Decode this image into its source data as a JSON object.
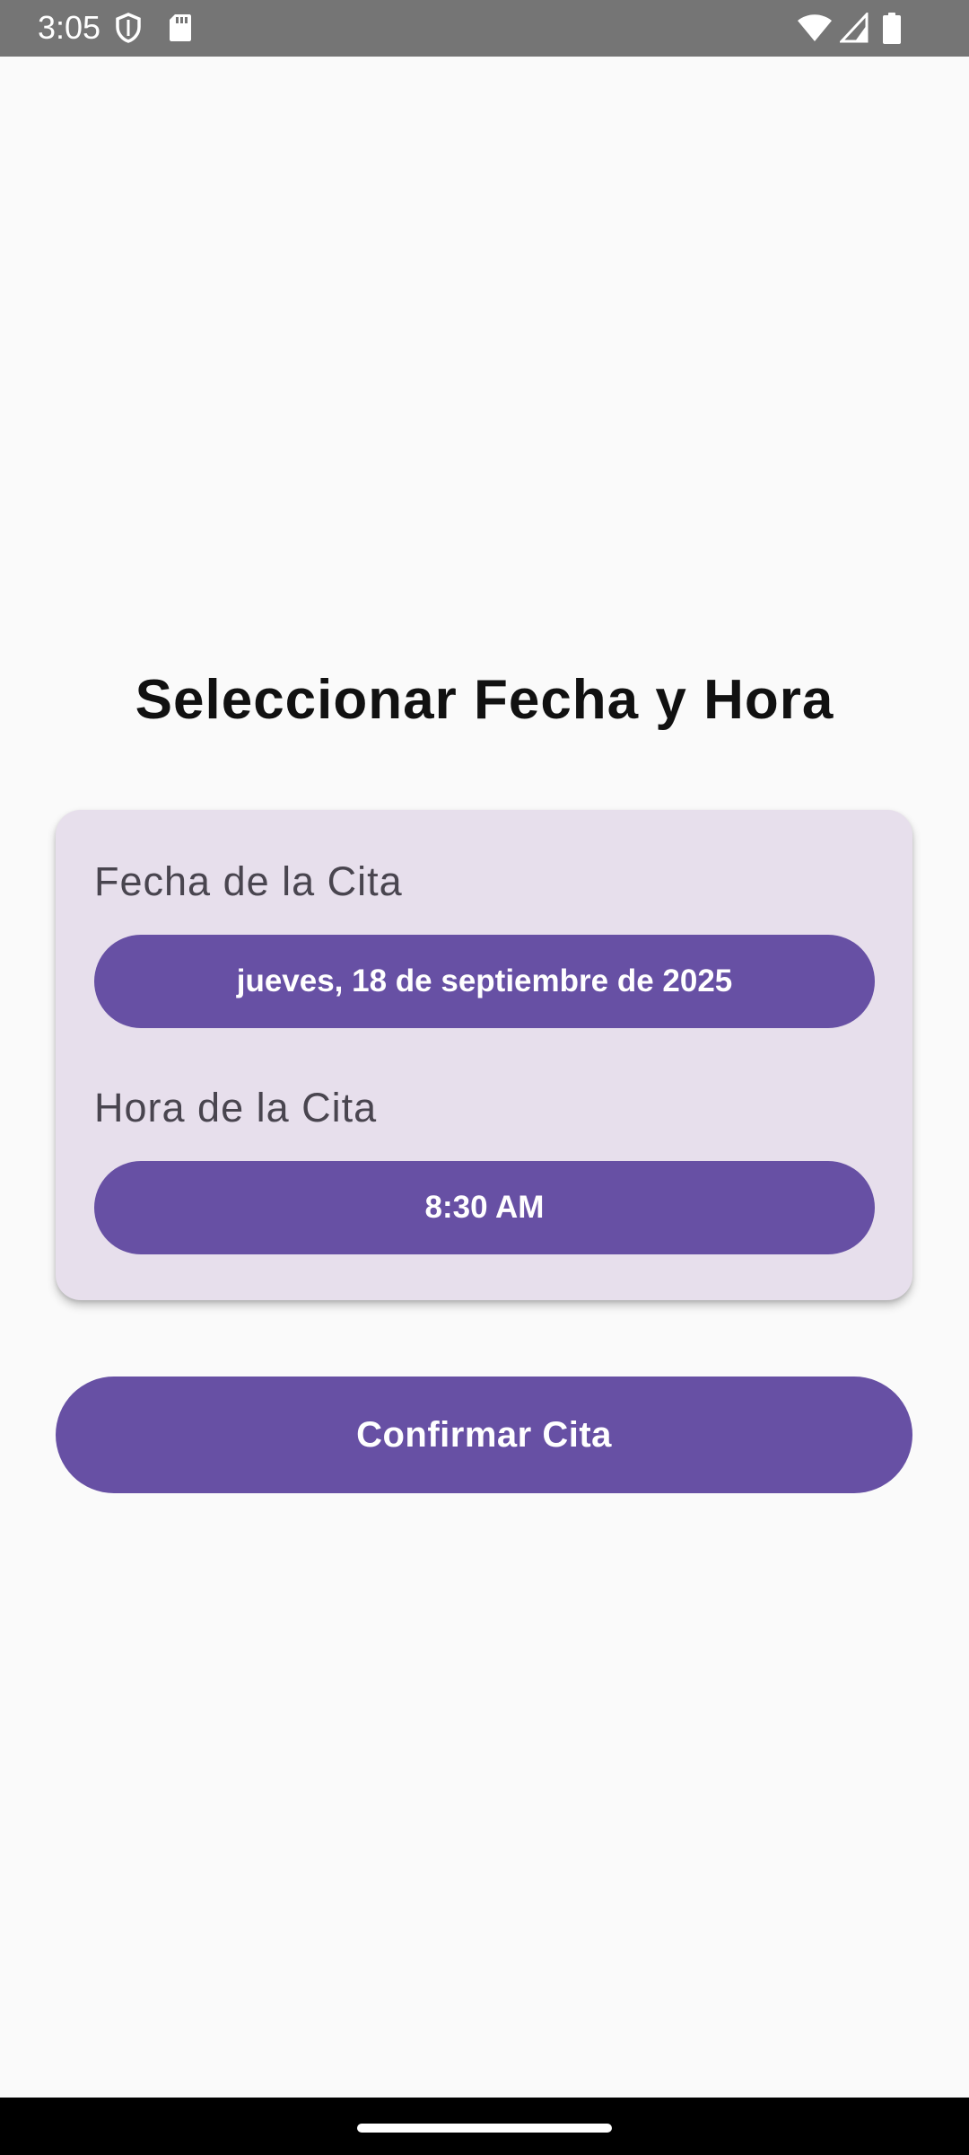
{
  "status_bar": {
    "time": "3:05",
    "left_icons": [
      "shield-icon",
      "sd-card-icon"
    ],
    "right_icons": [
      "wifi-icon",
      "signal-icon",
      "battery-icon"
    ]
  },
  "page": {
    "title": "Seleccionar Fecha y Hora"
  },
  "card": {
    "date_label": "Fecha de la Cita",
    "date_value": "jueves, 18 de septiembre de 2025",
    "time_label": "Hora de la Cita",
    "time_value": "8:30 AM"
  },
  "actions": {
    "confirm_label": "Confirmar Cita"
  },
  "colors": {
    "primary": "#6750A4",
    "card_background": "#E7DFEC",
    "page_background": "#FAFAFA",
    "status_bar": "#757575"
  }
}
